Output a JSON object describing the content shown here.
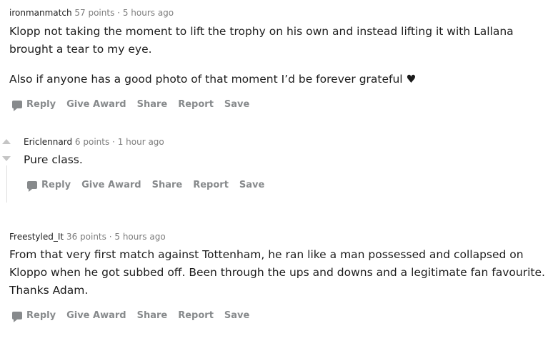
{
  "comments": [
    {
      "author": "ironmanmatch",
      "points": "57 points",
      "separator": "·",
      "time": "5 hours ago",
      "paragraphs": [
        "Klopp not taking the moment to lift the trophy on his own and instead lifting it with Lallana brought a tear to my eye.",
        "Also if anyone has a good photo of that moment I’d be forever grateful ♥"
      ]
    },
    {
      "author": "Ericlennard",
      "points": "6 points",
      "separator": "·",
      "time": "1 hour ago",
      "paragraphs": [
        "Pure class."
      ]
    },
    {
      "author": "Freestyled_It",
      "points": "36 points",
      "separator": "·",
      "time": "5 hours ago",
      "paragraphs": [
        "From that very first match against Tottenham, he ran like a man possessed and collapsed on Kloppo when he got subbed off. Been through the ups and downs and a legitimate fan favourite. Thanks Adam."
      ]
    }
  ],
  "actions": {
    "reply": "Reply",
    "give_award": "Give Award",
    "share": "Share",
    "report": "Report",
    "save": "Save"
  },
  "icons": {
    "reply": "comment-bubble-icon",
    "upvote": "upvote-arrow-icon",
    "downvote": "downvote-arrow-icon"
  },
  "colors": {
    "text": "#1c1c1c",
    "meta": "#7c7c7c",
    "action": "#878a8c",
    "vote_arrow": "#c5c5c5",
    "thread_line": "#dedede"
  }
}
